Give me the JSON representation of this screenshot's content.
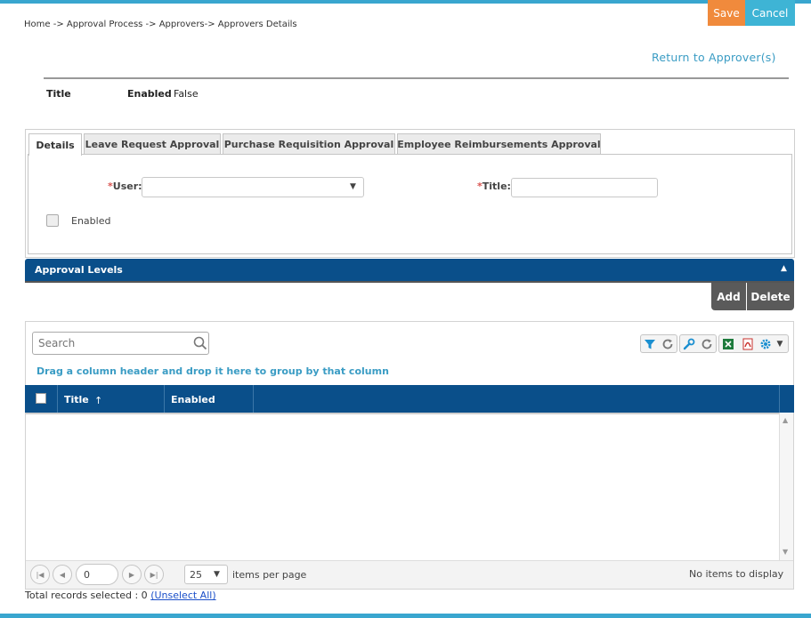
{
  "toolbar": {
    "save_label": "Save",
    "cancel_label": "Cancel"
  },
  "breadcrumb": "Home -> Approval Process -> Approvers-> Approvers Details",
  "return_link": "Return to Approver(s)",
  "info": {
    "title_label": "Title",
    "enabled_label": "Enabled",
    "enabled_value": "False"
  },
  "tabs": [
    {
      "label": "Details",
      "active": true
    },
    {
      "label": "Leave Request Approval",
      "active": false
    },
    {
      "label": "Purchase Requisition Approval",
      "active": false
    },
    {
      "label": "Employee Reimbursements Approval",
      "active": false
    }
  ],
  "form": {
    "required_mark": "*",
    "user_label": "User",
    "user_value": "",
    "title_label": "Title",
    "colon": ":",
    "title_value": "",
    "enabled_label": "Enabled",
    "enabled_checked": false
  },
  "approval_levels": {
    "header": "Approval Levels",
    "add_label": "Add",
    "delete_label": "Delete"
  },
  "grid": {
    "search_placeholder": "Search",
    "group_hint": "Drag a column header and drop it here to group by that column",
    "columns": [
      "Title",
      "Enabled"
    ],
    "sort_arrow": "↑",
    "rows": []
  },
  "pager": {
    "page_value": "0",
    "page_size": "25",
    "items_per_page": "items per page",
    "no_items": "No items to display"
  },
  "footer": {
    "total_selected": "Total records selected : 0",
    "unselect_all": "(Unselect All)"
  },
  "colors": {
    "accent_blue": "#0a4f8a",
    "save_orange": "#f08a3c",
    "cancel_cyan": "#3eb4d5",
    "link_blue": "#3a9cc4"
  },
  "icons": [
    "filter-icon",
    "refresh-icon",
    "wrench-icon",
    "refresh-icon",
    "excel-icon",
    "pdf-icon",
    "gear-icon",
    "chevron-down-icon",
    "search-icon"
  ]
}
